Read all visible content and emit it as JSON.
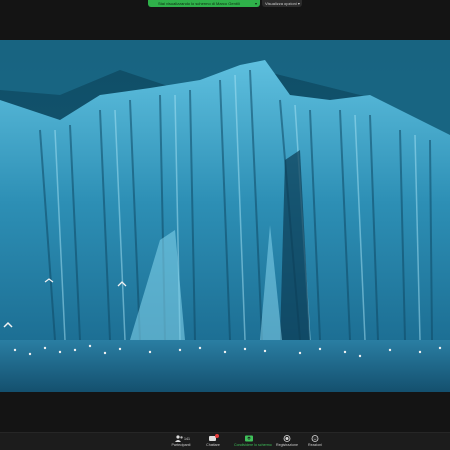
{
  "banner": {
    "sharing_text": "Stai visualizzando lo schermo di Marco Gentili",
    "view_options_label": "Visualizza opzioni"
  },
  "toolbar": {
    "items": [
      {
        "label": "Partecipanti",
        "icon": "participants-icon",
        "count": "141"
      },
      {
        "label": "Chattare",
        "icon": "chat-icon",
        "badge": "1"
      },
      {
        "label": "Condividere lo schermo",
        "icon": "share-screen-icon"
      },
      {
        "label": "Registrazione",
        "icon": "record-icon"
      },
      {
        "label": "Reazioni",
        "icon": "reactions-icon"
      }
    ]
  },
  "colors": {
    "share_green": "#2fb14a",
    "ice_blue": "#2a8ab0",
    "water": "#1d6f93"
  }
}
